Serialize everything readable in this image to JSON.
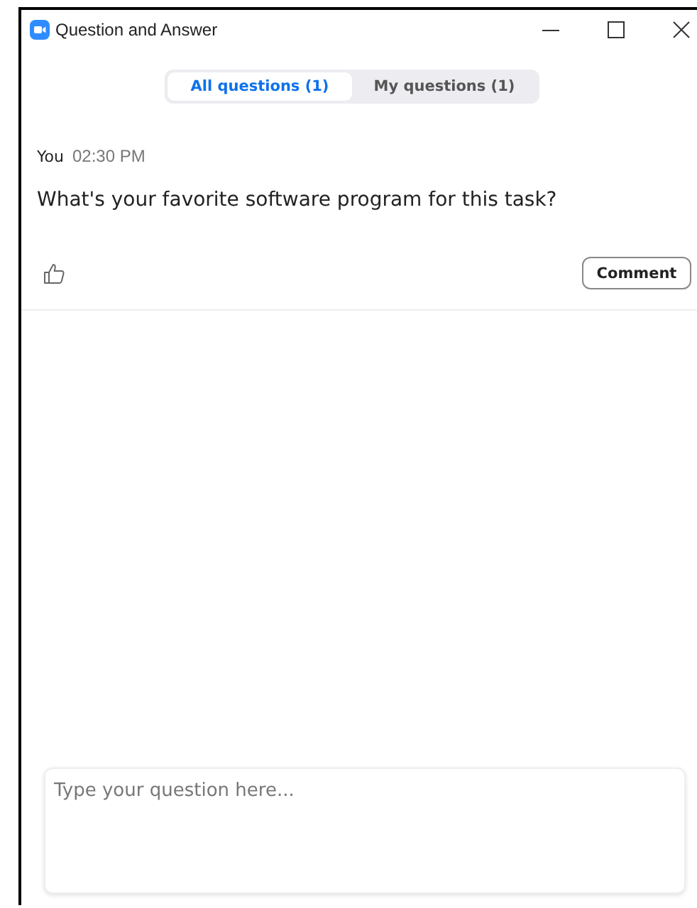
{
  "window": {
    "title": "Question and Answer"
  },
  "tabs": [
    {
      "label": "All questions (1)",
      "selected": true
    },
    {
      "label": "My questions (1)",
      "selected": false
    }
  ],
  "questions": [
    {
      "author": "You",
      "time": "02:30 PM",
      "text": "What's your favorite software program for this task?",
      "liked": false,
      "action": "Comment"
    }
  ],
  "input": {
    "placeholder": "Type your question here..."
  }
}
